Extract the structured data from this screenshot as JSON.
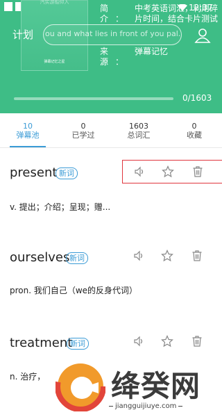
{
  "header": {
    "title": "计划",
    "cover_top_text": "汽实游船仰入",
    "cover_bottom_text": "弹幕记忆之星",
    "marquee_text": "ou and what lies in front of you pal.",
    "info": [
      {
        "key": "简　介：",
        "value": "中考英语词汇，利用碎片时间，结合卡片测试"
      },
      {
        "key": "来　源：",
        "value": "弹幕记忆"
      }
    ],
    "status_time": "12:37",
    "progress": {
      "done": 0,
      "total": 1603,
      "label": "0/1603"
    }
  },
  "tabs": [
    {
      "num": "10",
      "label": "弹幕池",
      "active": true
    },
    {
      "num": "0",
      "label": "已学过",
      "active": false
    },
    {
      "num": "1603",
      "label": "总词汇",
      "active": false
    },
    {
      "num": "0",
      "label": "收藏",
      "active": false
    }
  ],
  "words": [
    {
      "word": "present",
      "badge": "新词",
      "definition": "v. 提出；介绍；呈现；赠..."
    },
    {
      "word": "ourselves",
      "badge": "新词",
      "definition": "pron. 我们自己（we的反身代词）"
    },
    {
      "word": "treatment",
      "badge": "新词",
      "definition": "n. 治疗，"
    }
  ],
  "watermark": {
    "brand": "绛癸网",
    "url": "jiangguijiuye.com"
  },
  "colors": {
    "header_green": "#3ebd86",
    "accent_blue": "#3a9bd6",
    "highlight_red": "#e0353d"
  }
}
